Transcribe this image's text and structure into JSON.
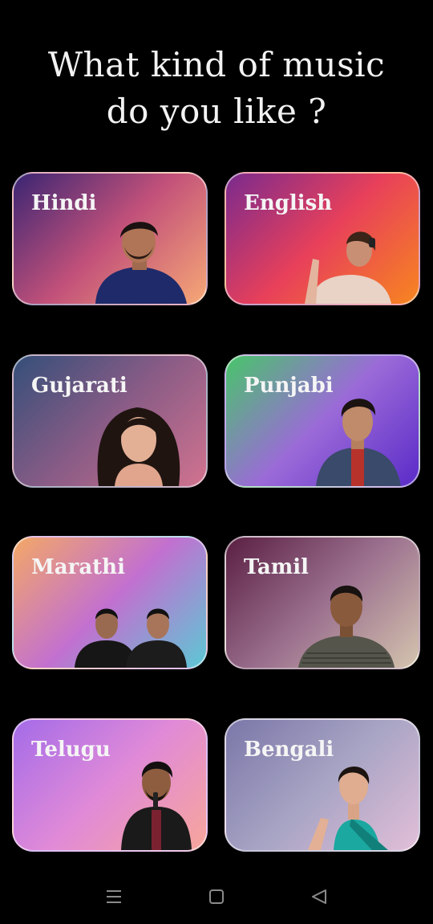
{
  "heading": {
    "line1": "What kind of music",
    "line2": "do you like ?"
  },
  "categories": [
    {
      "label": "Hindi",
      "colors": [
        "#3a2573",
        "#c2517a",
        "#f6a876"
      ]
    },
    {
      "label": "English",
      "colors": [
        "#7a2a8e",
        "#e8405a",
        "#f7861f"
      ]
    },
    {
      "label": "Gujarati",
      "colors": [
        "#344f79",
        "#8a5c86",
        "#d1738f"
      ]
    },
    {
      "label": "Punjabi",
      "colors": [
        "#48c56a",
        "#9b6ad8",
        "#5a2bc8"
      ]
    },
    {
      "label": "Marathi",
      "colors": [
        "#f3a866",
        "#c270d0",
        "#5cc8d4"
      ]
    },
    {
      "label": "Tamil",
      "colors": [
        "#5a1f42",
        "#9a6f8e",
        "#d4c4ae"
      ]
    },
    {
      "label": "Telugu",
      "colors": [
        "#a46be8",
        "#e08ad8",
        "#f7a69b"
      ]
    },
    {
      "label": "Bengali",
      "colors": [
        "#7b77a8",
        "#a7a4c4",
        "#e2bfd8"
      ]
    }
  ],
  "nav": {
    "menu_icon": "menu-icon",
    "home_icon": "home-square-icon",
    "back_icon": "back-triangle-icon"
  }
}
